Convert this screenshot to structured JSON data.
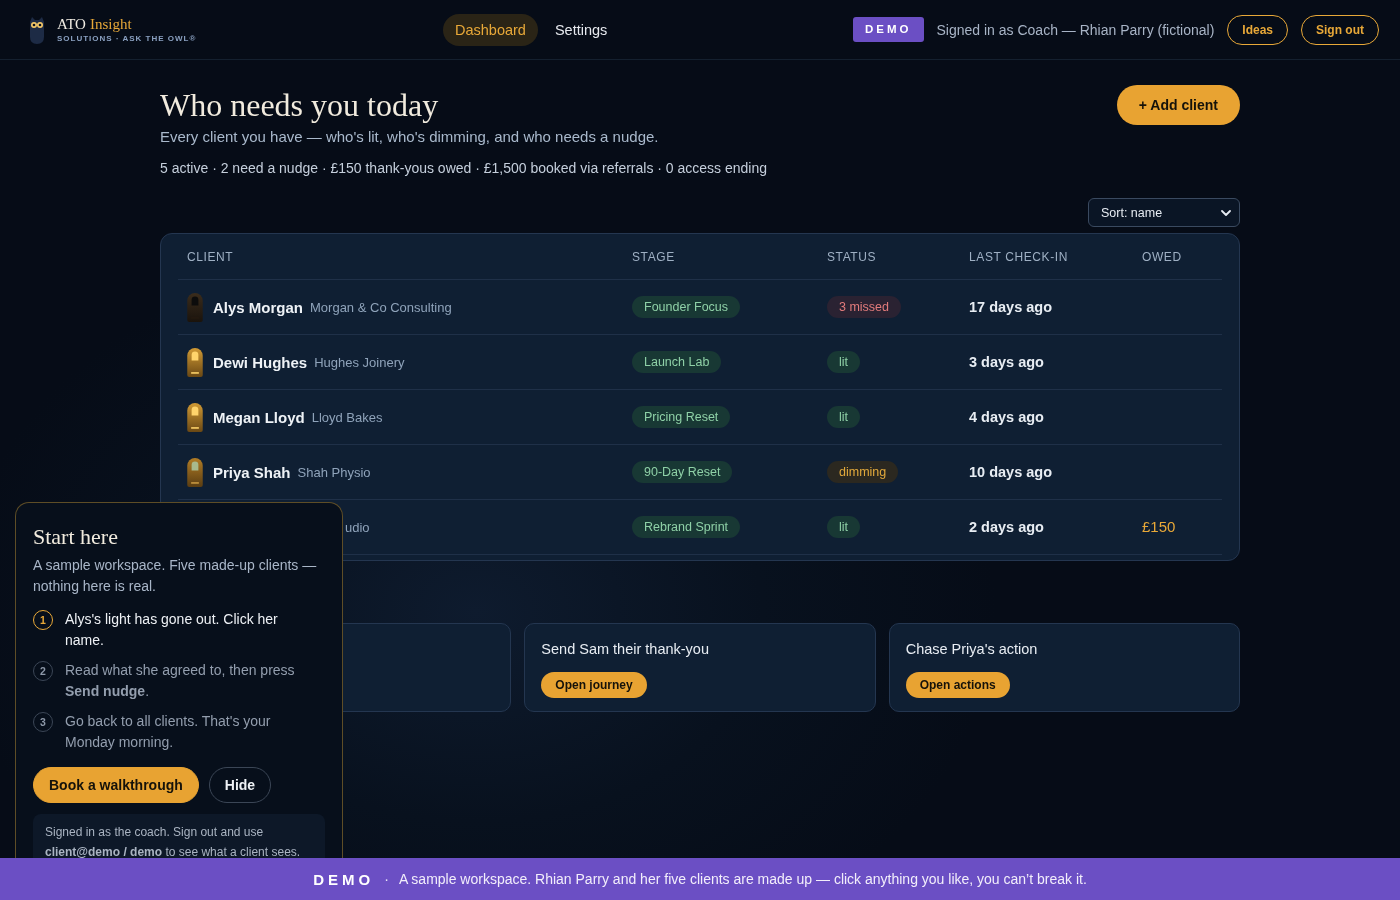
{
  "header": {
    "logo": {
      "name": "ATO",
      "accent": "Insight",
      "tagline": "SOLUTIONS · ASK THE OWL®"
    },
    "nav": [
      {
        "label": "Dashboard",
        "selected": true
      },
      {
        "label": "Settings",
        "selected": false
      }
    ],
    "demo_badge": "DEMO",
    "signed_in": "Signed in as Coach — Rhian Parry (fictional)",
    "buttons": [
      "Ideas",
      "Sign out"
    ]
  },
  "page": {
    "title": "Who needs you today",
    "subtitle": "Every client you have — who's lit, who's dimming, and who needs a nudge.",
    "stats": "5 active · 2 need a nudge · £150 thank-yous owed · £1,500 booked via referrals · 0 access ending",
    "add_button": "+ Add client",
    "sort": "Sort: name"
  },
  "table": {
    "columns": [
      "CLIENT",
      "STAGE",
      "STATUS",
      "LAST CHECK-IN",
      "OWED"
    ],
    "rows": [
      {
        "kind": "out",
        "name": "Alys Morgan",
        "company": "Morgan & Co Consulting",
        "stage": "Founder Focus",
        "status": "3 missed",
        "last_check_in": "17 days ago"
      },
      {
        "kind": "lit",
        "name": "Dewi Hughes",
        "company": "Hughes Joinery",
        "stage": "Launch Lab",
        "status": "lit",
        "last_check_in": "3 days ago"
      },
      {
        "kind": "lit",
        "name": "Megan Lloyd",
        "company": "Lloyd Bakes",
        "stage": "Pricing Reset",
        "status": "lit",
        "last_check_in": "4 days ago"
      },
      {
        "kind": "dimming",
        "name": "Priya Shah",
        "company": "Shah Physio",
        "stage": "90-Day Reset",
        "status": "dimming",
        "last_check_in": "10 days ago"
      },
      {
        "kind": "lit",
        "company": "udio",
        "stage": "Rebrand Sprint",
        "status": "lit",
        "last_check_in": "2 days ago",
        "owed": "£150"
      }
    ]
  },
  "nudge_cards": [
    {
      "kind": "covered"
    },
    {
      "kind": "action",
      "title": "Send Sam their thank-you",
      "button": "Open journey"
    },
    {
      "kind": "action",
      "title": "Chase Priya's action",
      "button": "Open actions"
    }
  ],
  "start_panel": {
    "title": "Start here",
    "intro": "A sample workspace. Five made-up clients — nothing here is real.",
    "steps": [
      {
        "number": "1",
        "text": "Alys's light has gone out. Click her name.",
        "selected": true
      },
      {
        "number": "2",
        "text": "Read what she agreed to, then press **Send nudge**.",
        "selected": false
      },
      {
        "number": "3",
        "text": "Go back to all clients. That's your Monday morning.",
        "selected": false
      }
    ],
    "buttons": [
      {
        "label": "Book a walkthrough",
        "kind": "primary"
      },
      {
        "label": "Hide",
        "kind": "outline"
      }
    ],
    "note": "Signed in as the coach. Sign out and use **client@demo / demo** to see what a client sees."
  },
  "demo_banner": {
    "badge": "DEMO",
    "separator": "·",
    "text": "A sample workspace. Rhian Parry and her five clients are made up — click anything you like, you can’t break it."
  }
}
